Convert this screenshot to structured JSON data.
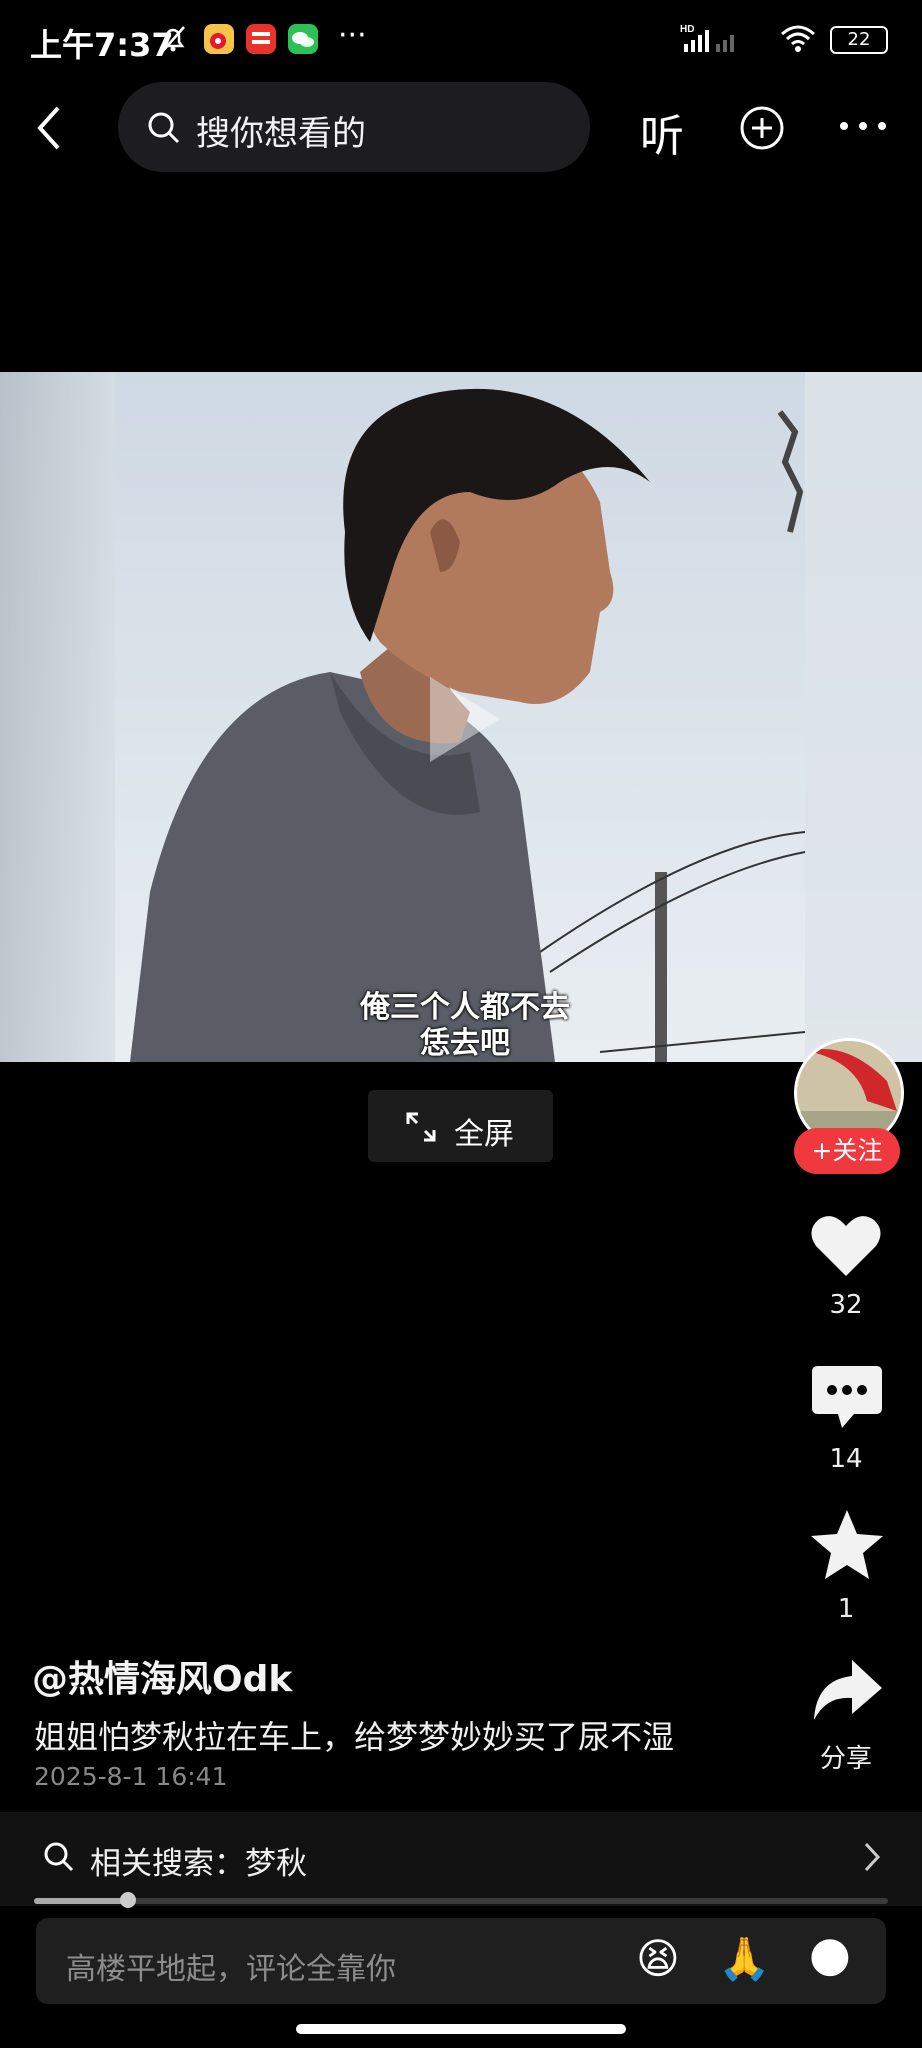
{
  "status_bar": {
    "time": "上午7:37",
    "battery": "22",
    "more": "···"
  },
  "top_nav": {
    "search_placeholder": "搜你想看的",
    "listen_label": "听"
  },
  "video": {
    "subtitle_line1": "俺三个人都不去",
    "subtitle_line2": "恁去吧",
    "fullscreen_label": "全屏"
  },
  "right_rail": {
    "follow_label": "+关注",
    "likes": "32",
    "comments": "14",
    "favorites": "1",
    "share_label": "分享"
  },
  "post": {
    "author": "@热情海风Odk",
    "description": "姐姐怕梦秋拉在车上，给梦梦妙妙买了尿不湿",
    "timestamp": "2025-8-1 16:41"
  },
  "related_search": {
    "text": "相关搜索：梦秋"
  },
  "progress": {
    "fraction": 0.11
  },
  "comment_bar": {
    "placeholder": "高楼平地起，评论全靠你",
    "emoji_1": "😫",
    "emoji_2": "🙏",
    "emoji_3": "🌑"
  },
  "colors": {
    "follow_red": "#f0393f",
    "background": "#000000"
  }
}
